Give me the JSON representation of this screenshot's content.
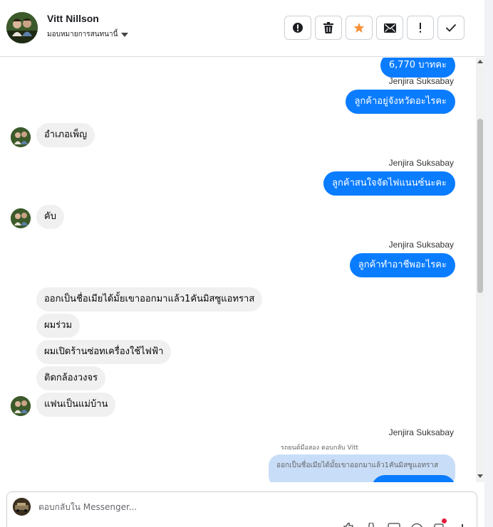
{
  "header": {
    "contact_name": "Vitt Nillson",
    "assign_label": "มอบหมายการสนทนานี้",
    "actions": [
      {
        "name": "spam-alert-button",
        "icon": "alert-circle-icon"
      },
      {
        "name": "delete-button",
        "icon": "trash-icon"
      },
      {
        "name": "star-button",
        "icon": "star-icon"
      },
      {
        "name": "mark-unread-button",
        "icon": "envelope-icon"
      },
      {
        "name": "follow-up-button",
        "icon": "exclamation-icon"
      },
      {
        "name": "mark-done-button",
        "icon": "check-icon"
      }
    ]
  },
  "colors": {
    "outgoing_bubble": "#0a7cff",
    "incoming_bubble": "#f0f0f0",
    "star_accent": "#f7923a",
    "reply_quote": "#c8ddf7"
  },
  "messages": {
    "m1": "6,770 บาทคะ",
    "s1": "Jenjira Suksabay",
    "m2": "ลูกค้าอยู่จังหวัดอะไรคะ",
    "m3": "อำเภอเพ็ญ",
    "s2": "Jenjira Suksabay",
    "m4": "ลูกค้าสนใจจัดไฟแนนซ์นะคะ",
    "m5": "คับ",
    "s3": "Jenjira Suksabay",
    "m6": "ลูกค้าทำอาชีพอะไรคะ",
    "m7": "ออกเป็นชื่อเมียได้มั้ยเขาออกมาแล้ว1คันมิสซูแอทราส",
    "m8": "ผมร่วม",
    "m9": "ผมเปิดร้านซ่อทเครื่องใช้ไฟฟ้า",
    "m10": "ติดกล้องวงจร",
    "m11": "แฟนเป็นแม่บ้าน",
    "s4": "Jenjira Suksabay",
    "reply_meta": "รถยนต์มือสอง ตอบกลับ Vitt",
    "reply_quote": "ออกเป็นชื่อเมียได้มั้ยเขาออกมาแล้ว1คันมิสซูแอทราส"
  },
  "composer": {
    "placeholder": "ตอบกลับใน Messenger..."
  }
}
